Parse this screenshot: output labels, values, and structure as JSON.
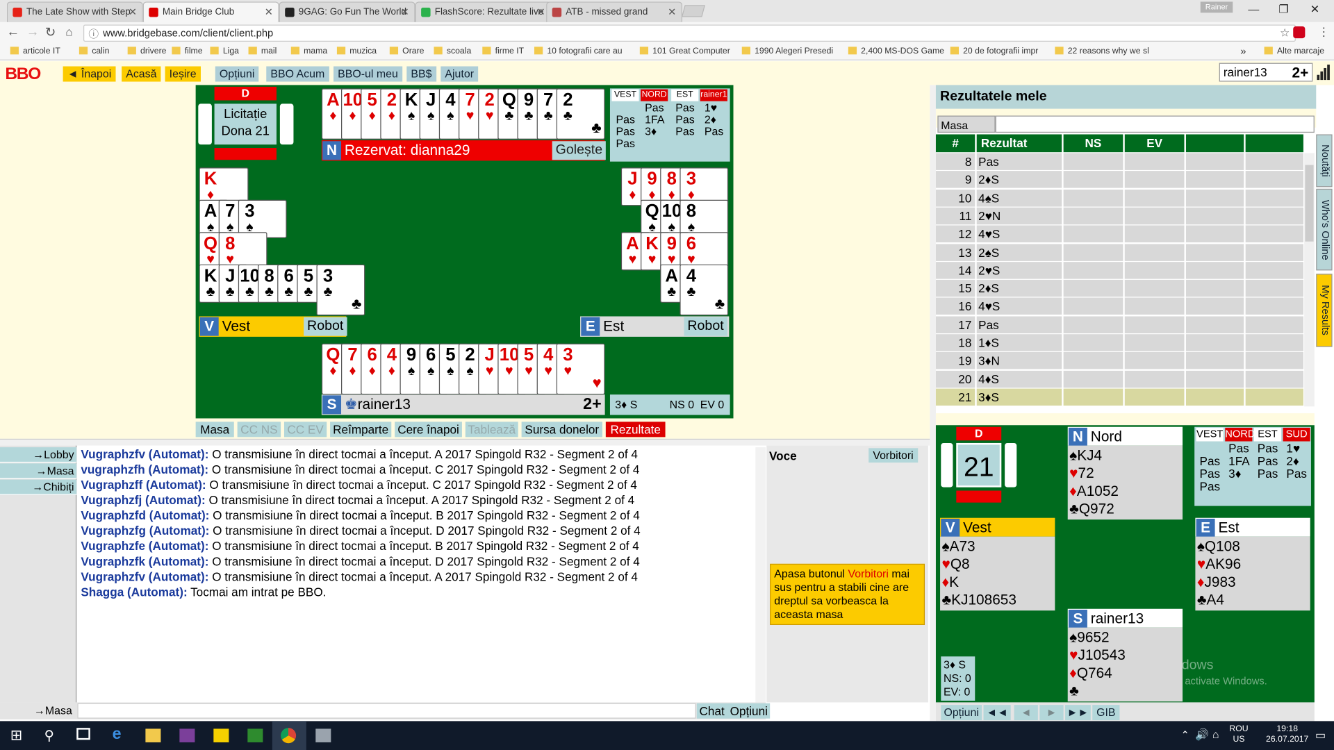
{
  "browser": {
    "tabs": [
      {
        "label": "The Late Show with Step",
        "color": "#e62117"
      },
      {
        "label": "Main Bridge Club",
        "color": "#d00"
      },
      {
        "label": "9GAG: Go Fun The World",
        "color": "#222"
      },
      {
        "label": "FlashScore: Rezultate live",
        "color": "#2bb24c"
      },
      {
        "label": "ATB - missed grand",
        "color": "#b44"
      }
    ],
    "user_chip": "Rainer",
    "url": "www.bridgebase.com/client/client.php",
    "bookmarks": [
      "articole IT",
      "calin",
      "drivere",
      "filme",
      "Liga",
      "mail",
      "mama",
      "muzica",
      "Orare",
      "scoala",
      "firme IT",
      "10 fotografii care au",
      "101 Great Computer",
      "1990 Alegeri Presedi",
      "2,400 MS-DOS Game",
      "20 de fotografii impr",
      "22 reasons why we sl"
    ],
    "bookmarks_more": "»",
    "other_bookmarks": "Alte marcaje"
  },
  "bbo": {
    "logo": "BBO",
    "nav_yellow": [
      "◄ Înapoi",
      "Acasă",
      "Ieșire"
    ],
    "nav_blue": [
      "Opțiuni",
      "BBO Acum",
      "BBO-ul meu",
      "BB$",
      "Ajutor"
    ],
    "username": "rainer13",
    "badge": "2+"
  },
  "table": {
    "dealer": "D",
    "board_label": "Licitație\nDona 21",
    "north": {
      "letter": "N",
      "label": "Rezervat: dianna29",
      "clear": "Golește",
      "cards": [
        [
          "A",
          "♦",
          "red"
        ],
        [
          "10",
          "♦",
          "red"
        ],
        [
          "5",
          "♦",
          "red"
        ],
        [
          "2",
          "♦",
          "red"
        ],
        [
          "K",
          "♠",
          "blk"
        ],
        [
          "J",
          "♠",
          "blk"
        ],
        [
          "4",
          "♠",
          "blk"
        ],
        [
          "7",
          "♥",
          "red"
        ],
        [
          "2",
          "♥",
          "red"
        ],
        [
          "Q",
          "♣",
          "blk"
        ],
        [
          "9",
          "♣",
          "blk"
        ],
        [
          "7",
          "♣",
          "blk"
        ],
        [
          "2",
          "♣",
          "blk"
        ]
      ]
    },
    "west": {
      "letter": "V",
      "label": "Vest",
      "robot": "Robot",
      "rows": [
        [
          [
            "K",
            "♦",
            "red"
          ]
        ],
        [
          [
            "A",
            "♠",
            "blk"
          ],
          [
            "7",
            "♠",
            "blk"
          ],
          [
            "3",
            "♠",
            "blk"
          ]
        ],
        [
          [
            "Q",
            "♥",
            "red"
          ],
          [
            "8",
            "♥",
            "red"
          ]
        ],
        [
          [
            "K",
            "♣",
            "blk"
          ],
          [
            "J",
            "♣",
            "blk"
          ],
          [
            "10",
            "♣",
            "blk"
          ],
          [
            "8",
            "♣",
            "blk"
          ],
          [
            "6",
            "♣",
            "blk"
          ],
          [
            "5",
            "♣",
            "blk"
          ],
          [
            "3",
            "♣",
            "blk"
          ]
        ]
      ]
    },
    "east": {
      "letter": "E",
      "label": "Est",
      "robot": "Robot",
      "rows": [
        [
          [
            "J",
            "♦",
            "red"
          ],
          [
            "9",
            "♦",
            "red"
          ],
          [
            "8",
            "♦",
            "red"
          ],
          [
            "3",
            "♦",
            "red"
          ]
        ],
        [
          [
            "Q",
            "♠",
            "blk"
          ],
          [
            "10",
            "♠",
            "blk"
          ],
          [
            "8",
            "♠",
            "blk"
          ]
        ],
        [
          [
            "A",
            "♥",
            "red"
          ],
          [
            "K",
            "♥",
            "red"
          ],
          [
            "9",
            "♥",
            "red"
          ],
          [
            "6",
            "♥",
            "red"
          ]
        ],
        [
          [
            "A",
            "♣",
            "blk"
          ],
          [
            "4",
            "♣",
            "blk"
          ]
        ]
      ]
    },
    "south": {
      "letter": "S",
      "label": "rainer13",
      "badge": "2+",
      "cards": [
        [
          "Q",
          "♦",
          "red"
        ],
        [
          "7",
          "♦",
          "red"
        ],
        [
          "6",
          "♦",
          "red"
        ],
        [
          "4",
          "♦",
          "red"
        ],
        [
          "9",
          "♠",
          "blk"
        ],
        [
          "6",
          "♠",
          "blk"
        ],
        [
          "5",
          "♠",
          "blk"
        ],
        [
          "2",
          "♠",
          "blk"
        ],
        [
          "J",
          "♥",
          "red"
        ],
        [
          "10",
          "♥",
          "red"
        ],
        [
          "5",
          "♥",
          "red"
        ],
        [
          "4",
          "♥",
          "red"
        ],
        [
          "3",
          "♥",
          "red"
        ]
      ]
    },
    "auction": {
      "headers": [
        "VEST",
        "NORD",
        "EST",
        "rainer1"
      ],
      "calls": [
        [
          "",
          "Pas",
          "Pas",
          "1♥"
        ],
        [
          "Pas",
          "1FA",
          "Pas",
          "2♦"
        ],
        [
          "Pas",
          "3♦",
          "Pas",
          "Pas"
        ],
        [
          "Pas",
          "",
          "",
          ""
        ]
      ]
    },
    "contract": {
      "text": "3♦ S",
      "ns": "NS 0",
      "ev": "EV 0"
    },
    "bottom_tabs": [
      "Masa",
      "CC NS",
      "CC EV",
      "Reîmparte",
      "Cere înapoi",
      "Tablează",
      "Sursa donelor",
      "Rezultate"
    ]
  },
  "chat": {
    "nav": [
      "→Lobby",
      "→Masa",
      "→Chibiți"
    ],
    "lines": [
      {
        "user": "Vugraphzfv (Automat):",
        "msg": " O transmisiune în direct tocmai a început. A 2017 Spingold R32 - Segment 2 of 4"
      },
      {
        "user": "vugraphzfh (Automat):",
        "msg": " O transmisiune în direct tocmai a început. C 2017 Spingold R32 - Segment 2 of 4"
      },
      {
        "user": "Vugraphzff (Automat):",
        "msg": " O transmisiune în direct tocmai a început. C 2017 Spingold R32 - Segment 2 of 4"
      },
      {
        "user": "Vugraphzfj (Automat):",
        "msg": " O transmisiune în direct tocmai a început. A 2017 Spingold R32 - Segment 2 of 4"
      },
      {
        "user": "Vugraphzfd (Automat):",
        "msg": " O transmisiune în direct tocmai a început. B 2017 Spingold R32 - Segment 2 of 4"
      },
      {
        "user": "Vugraphzfg (Automat):",
        "msg": " O transmisiune în direct tocmai a început. D 2017 Spingold R32 - Segment 2 of 4"
      },
      {
        "user": "Vugraphzfe (Automat):",
        "msg": " O transmisiune în direct tocmai a început. B 2017 Spingold R32 - Segment 2 of 4"
      },
      {
        "user": "Vugraphzfk (Automat):",
        "msg": " O transmisiune în direct tocmai a început. D 2017 Spingold R32 - Segment 2 of 4"
      },
      {
        "user": "Vugraphzfv (Automat):",
        "msg": " O transmisiune în direct tocmai a început. A 2017 Spingold R32 - Segment 2 of 4"
      },
      {
        "user": "Shagga (Automat):",
        "msg": " Tocmai am intrat pe BBO."
      }
    ],
    "input_target": "→Masa",
    "btn_chat": "Chat",
    "btn_options": "Opțiuni",
    "voce_label": "Voce",
    "vorbitori_btn": "Vorbitori",
    "voce_note_a": "Apasa butonul ",
    "voce_note_hl": "Vorbitori",
    "voce_note_b": " mai sus pentru a stabili cine are dreptul sa vorbeasca la aceasta masa"
  },
  "results": {
    "title": "Rezultatele mele",
    "masa_mea": "Masa mea",
    "columns": [
      "#",
      "Rezultat",
      "NS",
      "EV"
    ],
    "rows": [
      [
        "8",
        "Pas"
      ],
      [
        "9",
        "2♦S"
      ],
      [
        "10",
        "4♠S"
      ],
      [
        "11",
        "2♥N"
      ],
      [
        "12",
        "4♥S"
      ],
      [
        "13",
        "2♠S"
      ],
      [
        "14",
        "2♥S"
      ],
      [
        "15",
        "2♦S"
      ],
      [
        "16",
        "4♥S"
      ],
      [
        "17",
        "Pas"
      ],
      [
        "18",
        "1♦S"
      ],
      [
        "19",
        "3♦N"
      ],
      [
        "20",
        "4♦S"
      ],
      [
        "21",
        "3♦S"
      ]
    ],
    "side_tabs": [
      "Noutăți",
      "Who's Online",
      "My Results"
    ]
  },
  "review": {
    "dealer": "D",
    "board": "21",
    "north": {
      "letter": "N",
      "name": "Nord",
      "suits": [
        [
          "♠",
          "KJ4",
          "blk"
        ],
        [
          "♥",
          "72",
          "red"
        ],
        [
          "♦",
          "A1052",
          "red"
        ],
        [
          "♣",
          "Q972",
          "blk"
        ]
      ]
    },
    "west": {
      "letter": "V",
      "name": "Vest",
      "suits": [
        [
          "♠",
          "A73",
          "blk"
        ],
        [
          "♥",
          "Q8",
          "red"
        ],
        [
          "♦",
          "K",
          "red"
        ],
        [
          "♣",
          "KJ108653",
          "blk"
        ]
      ]
    },
    "east": {
      "letter": "E",
      "name": "Est",
      "suits": [
        [
          "♠",
          "Q108",
          "blk"
        ],
        [
          "♥",
          "AK96",
          "red"
        ],
        [
          "♦",
          "J983",
          "red"
        ],
        [
          "♣",
          "A4",
          "blk"
        ]
      ]
    },
    "south": {
      "letter": "S",
      "name": "rainer13",
      "suits": [
        [
          "♠",
          "9652",
          "blk"
        ],
        [
          "♥",
          "J10543",
          "red"
        ],
        [
          "♦",
          "Q764",
          "red"
        ],
        [
          "♣",
          "",
          "blk"
        ]
      ]
    },
    "auction": {
      "headers": [
        "VEST",
        "NORD",
        "EST",
        "SUD"
      ],
      "calls": [
        [
          "",
          "Pas",
          "Pas",
          "1♥"
        ],
        [
          "Pas",
          "1FA",
          "Pas",
          "2♦"
        ],
        [
          "Pas",
          "3♦",
          "Pas",
          "Pas"
        ],
        [
          "Pas",
          "",
          "",
          ""
        ]
      ]
    },
    "contract": [
      "3♦ S",
      "NS: 0",
      "EV: 0"
    ],
    "watermark1": "Activate Windows",
    "watermark2": "Go to Settings to activate Windows.",
    "bar": [
      "Opțiuni",
      "◄◄",
      "◄",
      "►",
      "►►",
      "GIB"
    ]
  },
  "taskbar": {
    "lang1": "ROU",
    "lang2": "US",
    "time": "19:18",
    "date": "26.07.2017"
  }
}
